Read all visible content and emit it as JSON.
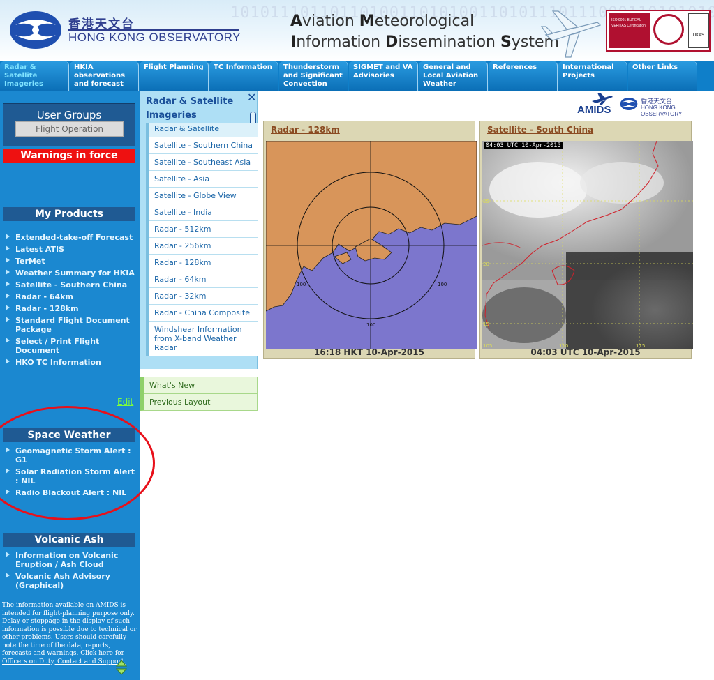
{
  "header": {
    "org_chinese": "香港天文台",
    "org_english": "HONG KONG OBSERVATORY",
    "title_line1_parts": [
      "A",
      "viation ",
      "M",
      "eteorological"
    ],
    "title_line2_parts": [
      "I",
      "nformation ",
      "D",
      "issemination ",
      "S",
      "ystem"
    ],
    "binary_text": "10101110110110100110101001101011101110001101010101101101",
    "cert_text": "ISO 9001 BUREAU VERITAS Certification",
    "ukas_text": "UKAS"
  },
  "nav": {
    "tabs": [
      {
        "label": "Radar & Satellite Imageries",
        "active": true
      },
      {
        "label": "HKIA observations and forecast",
        "active": false
      },
      {
        "label": "Flight Planning",
        "active": false
      },
      {
        "label": "TC Information",
        "active": false
      },
      {
        "label": "Thunderstorm and Significant Convection",
        "active": false
      },
      {
        "label": "SIGMET and VA Advisories",
        "active": false
      },
      {
        "label": "General and Local Aviation Weather",
        "active": false
      },
      {
        "label": "References",
        "active": false
      },
      {
        "label": "International Projects",
        "active": false
      },
      {
        "label": "Other Links",
        "active": false
      }
    ]
  },
  "sidebar": {
    "user_groups_title": "User Groups",
    "user_group_selected": "Flight Operation",
    "warnings_label": "Warnings in force",
    "my_products_title": "My Products",
    "products": [
      "Extended-take-off Forecast",
      "Latest ATIS",
      "TerMet",
      "Weather Summary for HKIA",
      "Satellite - Southern China",
      "Radar - 64km",
      "Radar - 128km",
      "Standard Flight Document Package",
      "Select / Print Flight Document",
      "HKO TC Information"
    ],
    "edit_label": "Edit",
    "space_weather_title": "Space Weather",
    "space_weather_items": [
      "Geomagnetic Storm Alert : G1",
      "Solar Radiation Storm Alert : NIL",
      "Radio Blackout Alert : NIL"
    ],
    "volcanic_title": "Volcanic Ash",
    "volcanic_items": [
      "Information on Volcanic Eruption / Ash Cloud",
      "Volcanic Ash Advisory (Graphical)"
    ],
    "disclaimer_text": "The information available on AMIDS is intended for flight-planning purpose only. Delay or stoppage in the display of such information is possible due to technical or other problems. Users should carefully note the time of the data, reports, forecasts and warnings. ",
    "disclaimer_link": "Click here for Officers on Duty, Contact and Support."
  },
  "submenu": {
    "title": "Radar & Satellite Imageries",
    "close_symbol": "✕",
    "items": [
      "Radar & Satellite",
      "Satellite - Southern China",
      "Satellite - Southeast Asia",
      "Satellite - Asia",
      "Satellite - Globe View",
      "Satellite - India",
      "Radar - 512km",
      "Radar - 256km",
      "Radar - 128km",
      "Radar - 64km",
      "Radar - 32km",
      "Radar - China Composite",
      "Windshear Information from X-band Weather Radar"
    ],
    "extra_items": [
      "What's New",
      "Previous Layout"
    ]
  },
  "main": {
    "amids_label": "AMIDS",
    "hko_small_chinese": "香港天文台",
    "hko_small_english": "HONG KONG OBSERVATORY",
    "radar_panel": {
      "title": "Radar - 128km",
      "caption": "16:18 HKT 10-Apr-2015",
      "ring_labels": [
        "100",
        "100",
        "100"
      ]
    },
    "satellite_panel": {
      "title": "Satellite - South China",
      "caption": "04:03 UTC 10-Apr-2015",
      "image_label": "04:03 UTC 10-Apr-2015",
      "lat_labels": [
        "25",
        "20",
        "15"
      ],
      "lon_labels": [
        "105",
        "110",
        "115"
      ]
    }
  },
  "colors": {
    "sidebar_bg": "#1b88d0",
    "nav_bg": "#0f7fc9",
    "warning_red": "#ee1111",
    "submenu_bg": "#aedff5",
    "panel_bg": "#dcd7b4",
    "land": "#d8955a",
    "sea": "#7c76cd"
  }
}
